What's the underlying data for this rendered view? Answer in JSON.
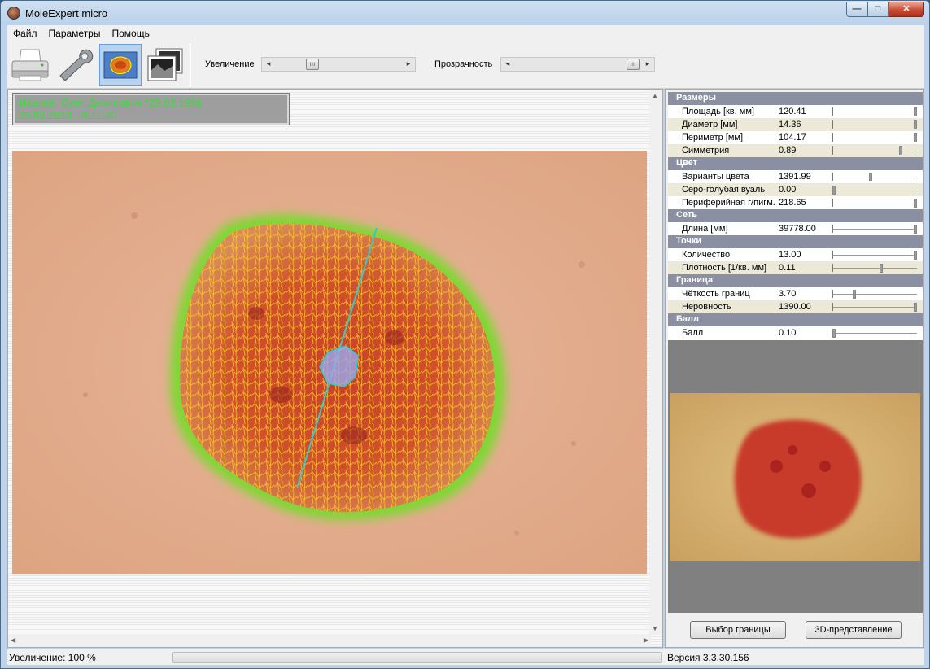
{
  "window": {
    "title": "MoleExpert micro"
  },
  "menu": [
    "Файл",
    "Параметры",
    "Помощь"
  ],
  "toolbar": {
    "tools": [
      "printer-icon",
      "wrench-icon",
      "mole-segmentation-icon",
      "images-icon"
    ],
    "active_tool": "mole-segmentation-icon",
    "zoom_label": "Увеличение",
    "opacity_label": "Прозрачность"
  },
  "patient": {
    "line1": "Иванов, Олег Денисович  *29.03.1966",
    "line2": "29.06.2013 - 0:11:40"
  },
  "params": {
    "sections": [
      {
        "title": "Размеры",
        "rows": [
          {
            "name": "Площадь [кв. мм]",
            "value": "120.41",
            "level": 1.0
          },
          {
            "name": "Диаметр [мм]",
            "value": "14.36",
            "level": 1.0
          },
          {
            "name": "Периметр [мм]",
            "value": "104.17",
            "level": 1.0
          },
          {
            "name": "Симметрия",
            "value": "0.89",
            "level": 0.82
          }
        ]
      },
      {
        "title": "Цвет",
        "rows": [
          {
            "name": "Варианты цвета",
            "value": "1391.99",
            "level": 0.45
          },
          {
            "name": "Серо-голубая вуаль",
            "value": "0.00",
            "level": 0.0
          },
          {
            "name": "Периферийная г/пигм.",
            "value": "218.65",
            "level": 1.0
          }
        ]
      },
      {
        "title": "Сеть",
        "rows": [
          {
            "name": "Длина [мм]",
            "value": "39778.00",
            "level": 1.0
          }
        ]
      },
      {
        "title": "Точки",
        "rows": [
          {
            "name": "Количество",
            "value": "13.00",
            "level": 1.0
          },
          {
            "name": "Плотность [1/кв. мм]",
            "value": "0.11",
            "level": 0.58
          }
        ]
      },
      {
        "title": "Граница",
        "rows": [
          {
            "name": "Чёткость границ",
            "value": "3.70",
            "level": 0.25
          },
          {
            "name": "Неровность",
            "value": "1390.00",
            "level": 1.0
          }
        ]
      },
      {
        "title": "Балл",
        "rows": [
          {
            "name": "Балл",
            "value": "0.10",
            "level": 0.0
          }
        ]
      }
    ]
  },
  "buttons": {
    "border_select": "Выбор границы",
    "view_3d": "3D-представление"
  },
  "status": {
    "zoom": "Увеличение: 100 %",
    "version": "Версия 3.3.30.156"
  }
}
